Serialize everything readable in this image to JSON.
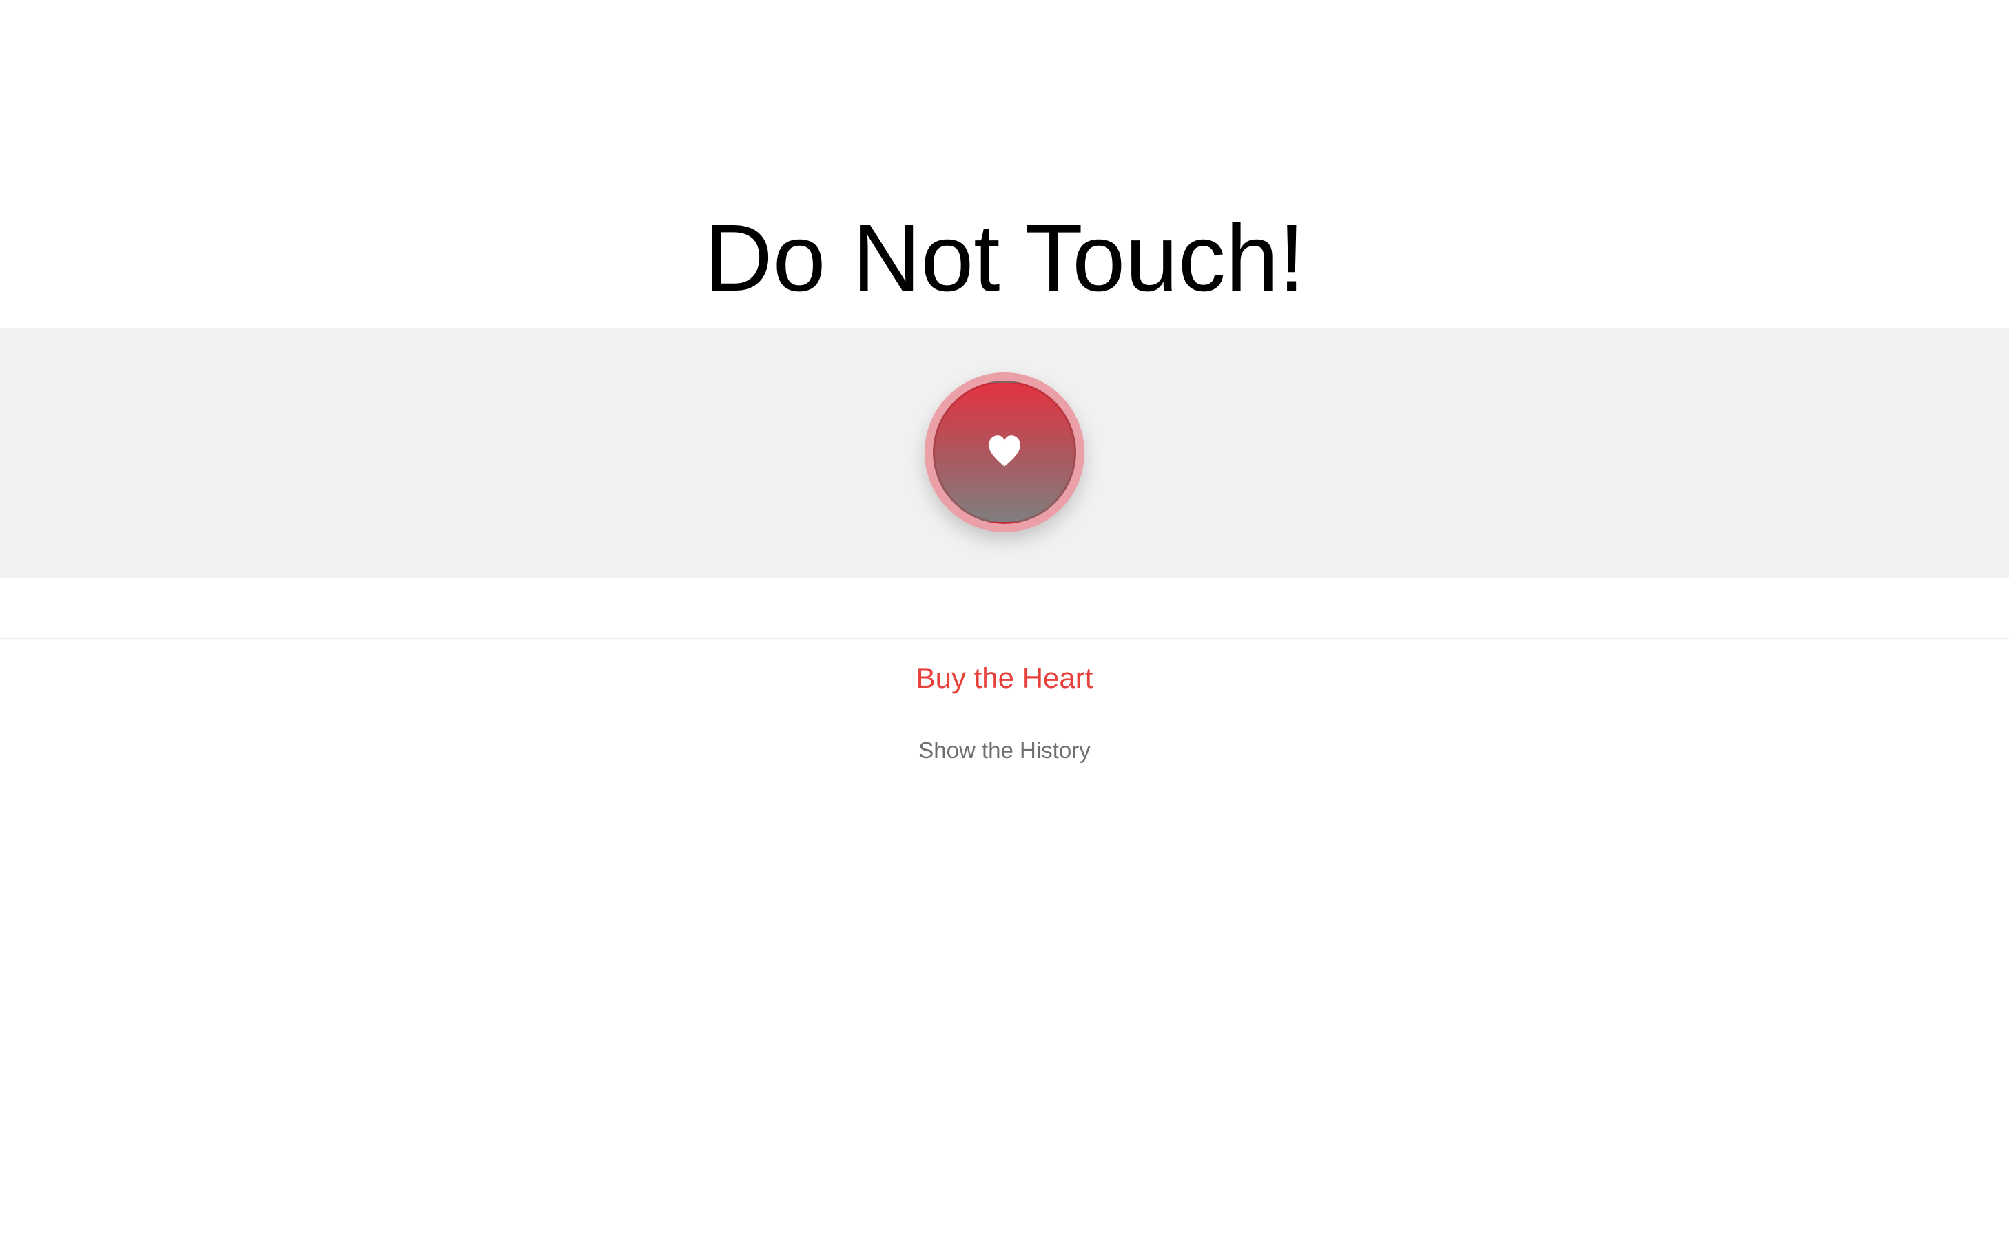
{
  "page": {
    "title": "Do Not Touch!"
  },
  "heart_button": {
    "icon": "heart-icon",
    "ring_color": "#eaa0a6",
    "gradient_top": "#e33340",
    "gradient_bottom": "#7f7f7f"
  },
  "links": {
    "buy_label": "Buy the Heart",
    "buy_color": "#e8403a",
    "history_label": "Show the History",
    "history_color": "#6f6f6f"
  },
  "colors": {
    "band_background": "#f1f1f1",
    "page_background": "#ffffff"
  }
}
